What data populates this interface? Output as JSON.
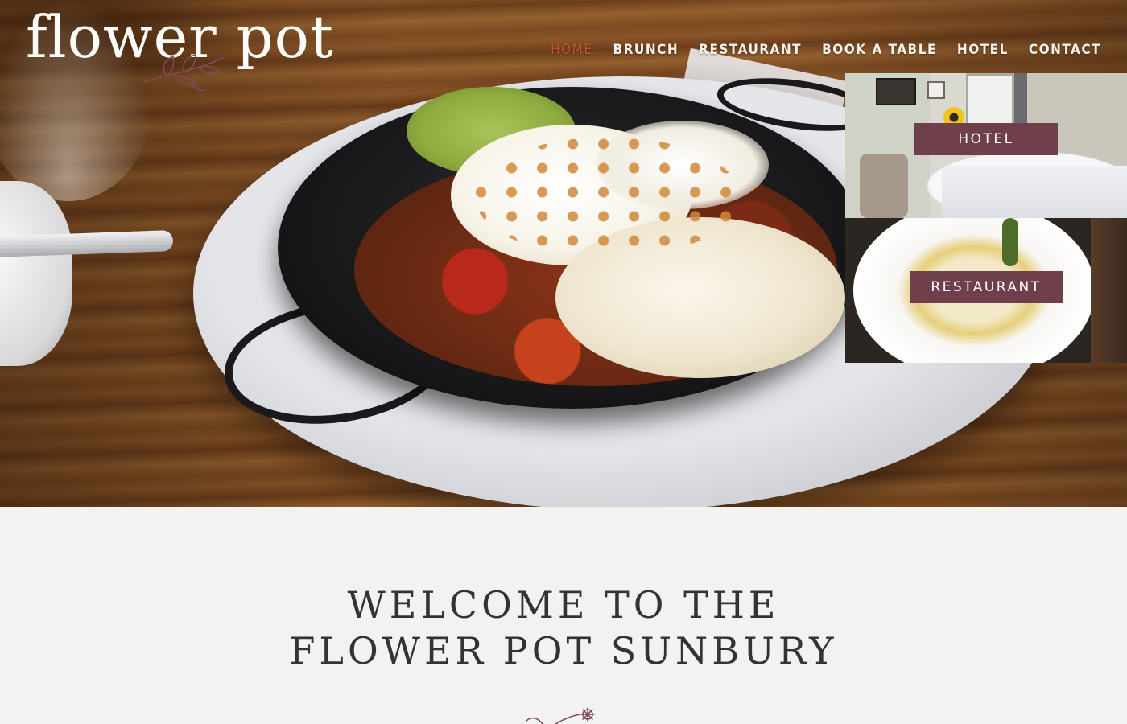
{
  "brand": {
    "logo_text": "flower pot"
  },
  "nav": {
    "items": [
      {
        "label": "HOME",
        "active": true
      },
      {
        "label": "BRUNCH",
        "active": false
      },
      {
        "label": "RESTAURANT",
        "active": false
      },
      {
        "label": "BOOK A TABLE",
        "active": false
      },
      {
        "label": "HOTEL",
        "active": false
      },
      {
        "label": "CONTACT",
        "active": false
      }
    ]
  },
  "feature_cards": {
    "hotel_label": "HOTEL",
    "restaurant_label": "RESTAURANT"
  },
  "welcome": {
    "line1": "WELCOME TO THE",
    "line2": "FLOWER POT SUNBURY"
  },
  "colors": {
    "accent_plum": "#6f3f4c",
    "nav_active": "#c1542f",
    "background": "#f2f2f0",
    "heading_text": "#333334"
  },
  "icons": {
    "logo_leaf": "leaf-sprig-icon",
    "divider": "flower-sprig-icon"
  }
}
